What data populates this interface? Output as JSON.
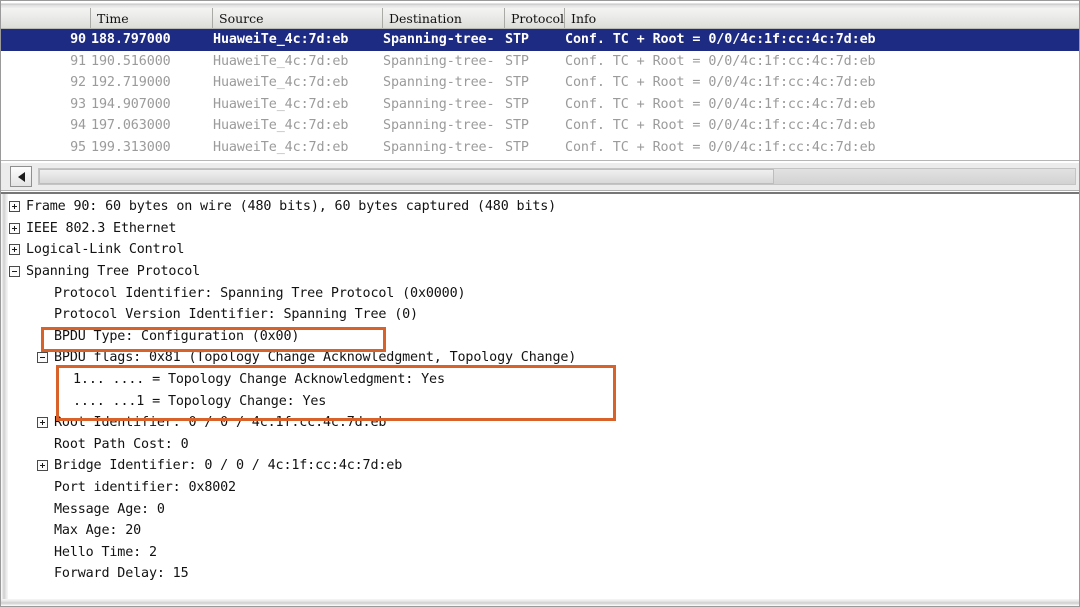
{
  "colors": {
    "selection": "#1d2b83",
    "highlight": "#d9622b",
    "row_text": "#9b9b9b",
    "tree_text": "#121212"
  },
  "packet_list": {
    "columns": [
      {
        "key": "no",
        "label": ""
      },
      {
        "key": "time",
        "label": "Time"
      },
      {
        "key": "source",
        "label": "Source"
      },
      {
        "key": "destination",
        "label": "Destination"
      },
      {
        "key": "protocol",
        "label": "Protocol"
      },
      {
        "key": "info",
        "label": "Info"
      }
    ],
    "rows": [
      {
        "no": "90",
        "time": "188.797000",
        "source": "HuaweiTe_4c:7d:eb",
        "destination": "Spanning-tree-",
        "protocol": "STP",
        "info": "Conf. TC + Root = 0/0/4c:1f:cc:4c:7d:eb",
        "selected": true
      },
      {
        "no": "91",
        "time": "190.516000",
        "source": "HuaweiTe_4c:7d:eb",
        "destination": "Spanning-tree-",
        "protocol": "STP",
        "info": "Conf. TC + Root = 0/0/4c:1f:cc:4c:7d:eb",
        "selected": false
      },
      {
        "no": "92",
        "time": "192.719000",
        "source": "HuaweiTe_4c:7d:eb",
        "destination": "Spanning-tree-",
        "protocol": "STP",
        "info": "Conf. TC + Root = 0/0/4c:1f:cc:4c:7d:eb",
        "selected": false
      },
      {
        "no": "93",
        "time": "194.907000",
        "source": "HuaweiTe_4c:7d:eb",
        "destination": "Spanning-tree-",
        "protocol": "STP",
        "info": "Conf. TC + Root = 0/0/4c:1f:cc:4c:7d:eb",
        "selected": false
      },
      {
        "no": "94",
        "time": "197.063000",
        "source": "HuaweiTe_4c:7d:eb",
        "destination": "Spanning-tree-",
        "protocol": "STP",
        "info": "Conf. TC + Root = 0/0/4c:1f:cc:4c:7d:eb",
        "selected": false
      },
      {
        "no": "95",
        "time": "199.313000",
        "source": "HuaweiTe_4c:7d:eb",
        "destination": "Spanning-tree-",
        "protocol": "STP",
        "info": "Conf. TC + Root = 0/0/4c:1f:cc:4c:7d:eb",
        "selected": false
      }
    ]
  },
  "scrollbar": {
    "left_arrow_icon": "triangle-left-icon"
  },
  "detail_tree": {
    "rows": [
      {
        "indent": 0,
        "expander": "plus",
        "text": "Frame 90: 60 bytes on wire (480 bits), 60 bytes captured (480 bits)"
      },
      {
        "indent": 0,
        "expander": "plus",
        "text": "IEEE 802.3 Ethernet"
      },
      {
        "indent": 0,
        "expander": "plus",
        "text": "Logical-Link Control"
      },
      {
        "indent": 0,
        "expander": "minus",
        "text": "Spanning Tree Protocol"
      },
      {
        "indent": 1,
        "expander": "none",
        "text": "Protocol Identifier: Spanning Tree Protocol (0x0000)"
      },
      {
        "indent": 1,
        "expander": "none",
        "text": "Protocol Version Identifier: Spanning Tree (0)"
      },
      {
        "indent": 1,
        "expander": "none",
        "text": "BPDU Type: Configuration (0x00)"
      },
      {
        "indent": 1,
        "expander": "minus",
        "text": "BPDU flags: 0x81 (Topology Change Acknowledgment, Topology Change)"
      },
      {
        "indent": 2,
        "expander": "none",
        "text": "1... .... = Topology Change Acknowledgment: Yes"
      },
      {
        "indent": 2,
        "expander": "none",
        "text": ".... ...1 = Topology Change: Yes"
      },
      {
        "indent": 1,
        "expander": "plus",
        "text": "Root Identifier: 0 / 0 / 4c:1f:cc:4c:7d:eb"
      },
      {
        "indent": 1,
        "expander": "none",
        "text": "Root Path Cost: 0"
      },
      {
        "indent": 1,
        "expander": "plus",
        "text": "Bridge Identifier: 0 / 0 / 4c:1f:cc:4c:7d:eb"
      },
      {
        "indent": 1,
        "expander": "none",
        "text": "Port identifier: 0x8002"
      },
      {
        "indent": 1,
        "expander": "none",
        "text": "Message Age: 0"
      },
      {
        "indent": 1,
        "expander": "none",
        "text": "Max Age: 20"
      },
      {
        "indent": 1,
        "expander": "none",
        "text": "Hello Time: 2"
      },
      {
        "indent": 1,
        "expander": "none",
        "text": "Forward Delay: 15"
      }
    ]
  },
  "annotations": [
    {
      "name": "highlight-bpdu-type",
      "target_text": "BPDU Type: Configuration (0x00)"
    },
    {
      "name": "highlight-topology-change-flags",
      "target_text": "Topology Change Acknowledgment / Topology Change bits"
    }
  ]
}
